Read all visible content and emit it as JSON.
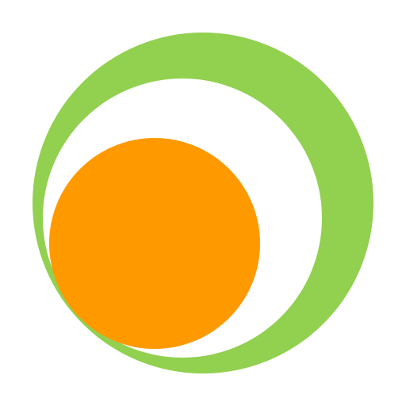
{
  "logo": {
    "name": "circle-logo",
    "colors": {
      "outer_ring": "#92D050",
      "inner_gap": "#FFFFFF",
      "sun": "#FF9900",
      "background": "#FFFFFF"
    }
  }
}
